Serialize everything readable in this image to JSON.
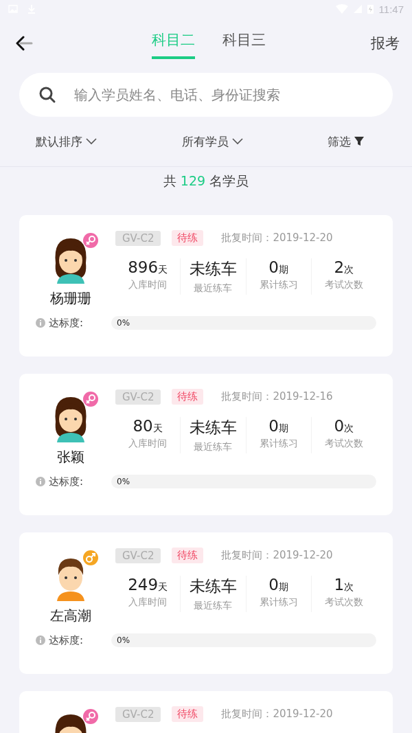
{
  "status_bar": {
    "time": "11:47"
  },
  "header": {
    "tabs": [
      {
        "label": "科目二",
        "selected": true
      },
      {
        "label": "科目三",
        "selected": false
      }
    ],
    "action": "报考"
  },
  "search": {
    "placeholder": "输入学员姓名、电话、身份证搜索"
  },
  "filters": [
    {
      "label": "默认排序",
      "kind": "dropdown"
    },
    {
      "label": "所有学员",
      "kind": "dropdown"
    },
    {
      "label": "筛选",
      "kind": "filter"
    }
  ],
  "count": {
    "prefix": "共",
    "number": "129",
    "suffix": "名学员"
  },
  "students": [
    {
      "name": "杨珊珊",
      "kind": "female",
      "license": "GV-C2",
      "status": "待练",
      "approval": "批复时间：2019-12-20",
      "stats": [
        {
          "value": "896",
          "unit": "天",
          "label": "入库时间"
        },
        {
          "value": "未练车",
          "label": "最近练车"
        },
        {
          "value": "0",
          "unit": "期",
          "label": "累计练习"
        },
        {
          "value": "2",
          "unit": "次",
          "label": "考试次数"
        }
      ],
      "progress_label": "达标度:",
      "level": 0,
      "reading": "0%"
    },
    {
      "name": "张颖",
      "kind": "female",
      "license": "GV-C2",
      "status": "待练",
      "approval": "批复时间：2019-12-16",
      "stats": [
        {
          "value": "80",
          "unit": "天",
          "label": "入库时间"
        },
        {
          "value": "未练车",
          "label": "最近练车"
        },
        {
          "value": "0",
          "unit": "期",
          "label": "累计练习"
        },
        {
          "value": "0",
          "unit": "次",
          "label": "考试次数"
        }
      ],
      "progress_label": "达标度:",
      "level": 0,
      "reading": "0%"
    },
    {
      "name": "左高潮",
      "kind": "male",
      "license": "GV-C2",
      "status": "待练",
      "approval": "批复时间：2019-12-20",
      "stats": [
        {
          "value": "249",
          "unit": "天",
          "label": "入库时间"
        },
        {
          "value": "未练车",
          "label": "最近练车"
        },
        {
          "value": "0",
          "unit": "期",
          "label": "累计练习"
        },
        {
          "value": "1",
          "unit": "次",
          "label": "考试次数"
        }
      ],
      "progress_label": "达标度:",
      "level": 0,
      "reading": "0%"
    },
    {
      "kind": "female",
      "license": "GV-C2",
      "status": "待练",
      "approval": "批复时间：2019-12-20"
    }
  ]
}
